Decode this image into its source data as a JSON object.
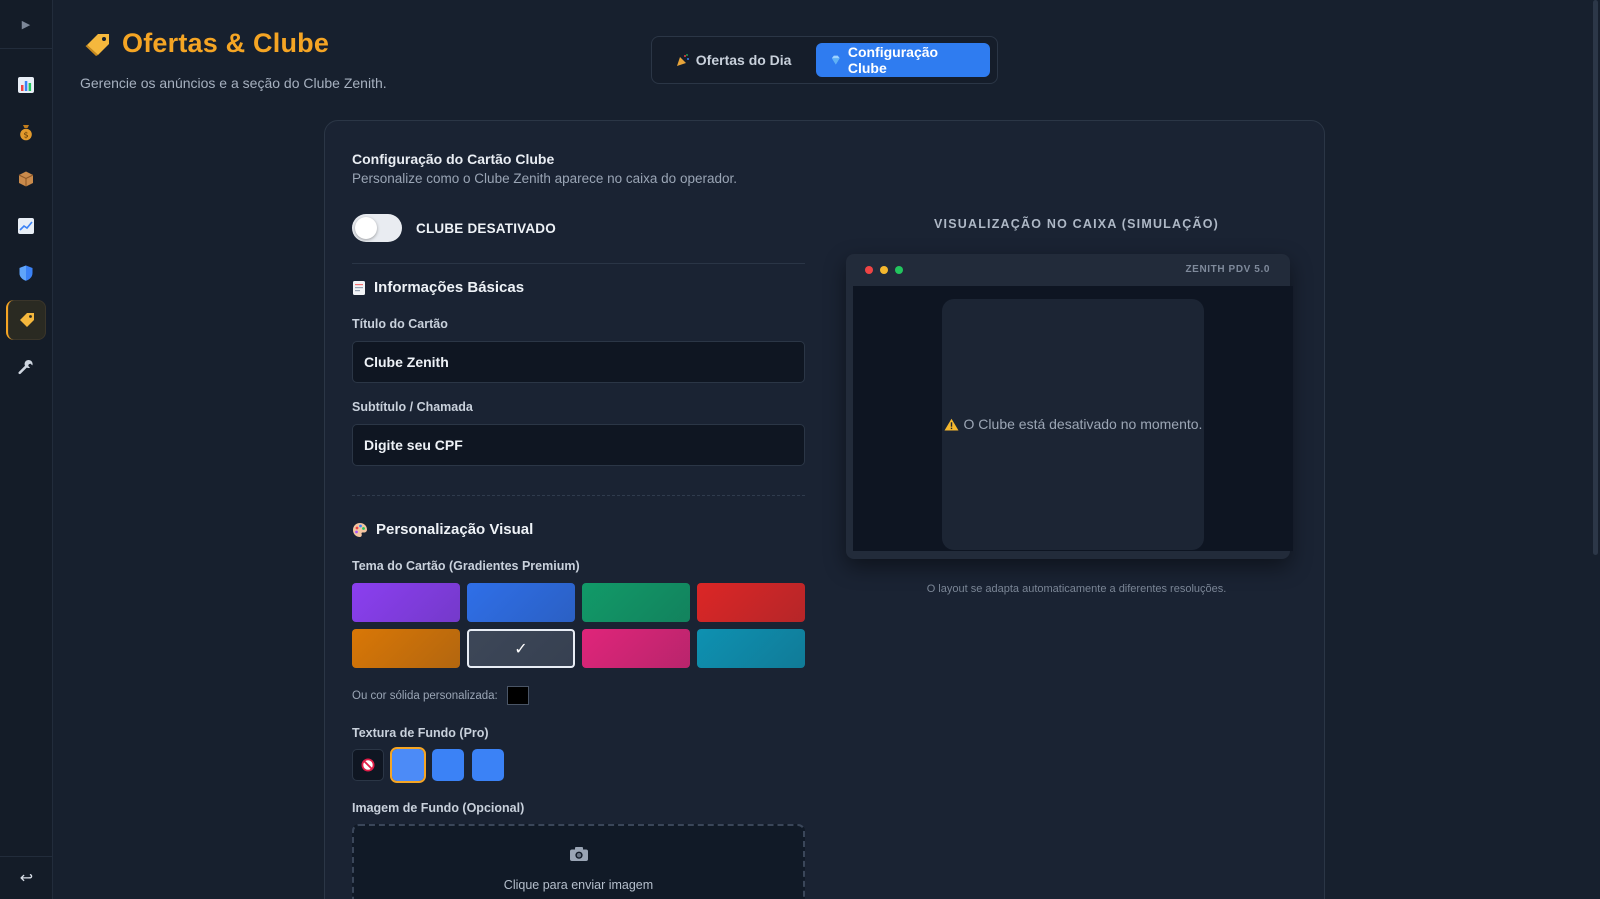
{
  "header": {
    "title": "Ofertas & Clube",
    "subtitle": "Gerencie os anúncios e a seção do Clube Zenith."
  },
  "tabs": [
    {
      "label": "Ofertas do Dia",
      "icon": "party-popper-icon",
      "active": false
    },
    {
      "label": "Configuração Clube",
      "icon": "diamond-icon",
      "active": true
    }
  ],
  "sidebar": {
    "toggle_icon": "▶",
    "items": [
      {
        "icon": "bar-chart-icon"
      },
      {
        "icon": "money-bag-icon"
      },
      {
        "icon": "package-icon"
      },
      {
        "icon": "trend-chart-icon"
      },
      {
        "icon": "shield-icon"
      },
      {
        "icon": "tag-icon",
        "active": true
      },
      {
        "icon": "wrench-icon"
      }
    ],
    "bottom_icon": "↩"
  },
  "config": {
    "title": "Configuração do Cartão Clube",
    "subtitle": "Personalize como o Clube Zenith aparece no caixa do operador.",
    "toggle_label": "CLUBE DESATIVADO",
    "toggle_on": false,
    "basic": {
      "title": "Informações Básicas",
      "card_title_label": "Título do Cartão",
      "card_title_value": "Clube Zenith",
      "subtitle_label": "Subtítulo / Chamada",
      "subtitle_value": "Digite seu CPF"
    },
    "visual": {
      "title": "Personalização Visual",
      "theme_label": "Tema do Cartão (Gradientes Premium)",
      "themes": [
        {
          "name": "purple",
          "color": "#8b3ff0",
          "selected": false
        },
        {
          "name": "blue",
          "color": "#2f6fe8",
          "selected": false
        },
        {
          "name": "green",
          "color": "#119a68",
          "selected": false
        },
        {
          "name": "red",
          "color": "#dc2626",
          "selected": false
        },
        {
          "name": "orange",
          "color": "#d97706",
          "selected": false
        },
        {
          "name": "slate",
          "color": "#3d4758",
          "selected": true
        },
        {
          "name": "pink",
          "color": "#e0257a",
          "selected": false
        },
        {
          "name": "teal",
          "color": "#0e91b1",
          "selected": false
        }
      ],
      "check_mark": "✓",
      "solid_label": "Ou cor sólida personalizada:",
      "solid_color": "#000000",
      "texture_label": "Textura de Fundo (Pro)",
      "bg_image_label": "Imagem de Fundo (Opcional)",
      "upload_text": "Clique para enviar imagem"
    }
  },
  "preview": {
    "title": "VISUALIZAÇÃO NO CAIXA (SIMULAÇÃO)",
    "brand": "ZENITH PDV 5.0",
    "message": "O Clube está desativado no momento.",
    "note": "O layout se adapta automaticamente a diferentes resoluções."
  },
  "colors": {
    "accent": "#f5a524",
    "primary": "#2f7cf0",
    "background": "#17202e"
  }
}
